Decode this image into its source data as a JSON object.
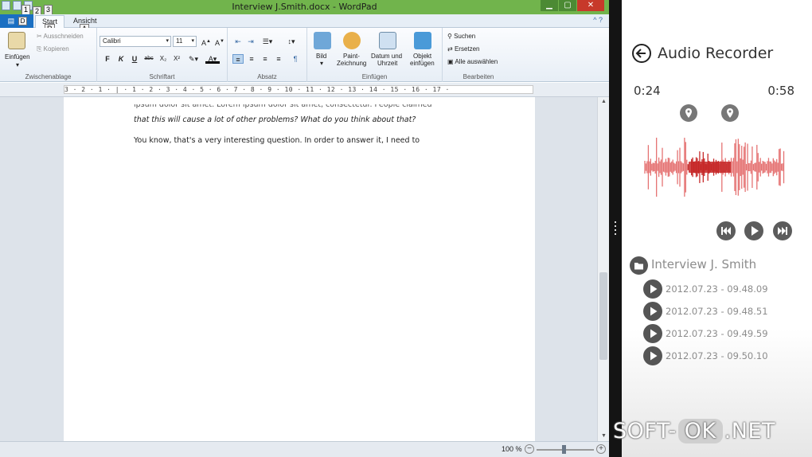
{
  "wordpad": {
    "window_title": "Interview J.Smith.docx - WordPad",
    "tabs": {
      "file_label": "",
      "file_keytip": "D",
      "start": "Start",
      "start_keytip": "R",
      "view": "Ansicht",
      "view_keytip": "A"
    },
    "qat_keytips": [
      "1",
      "2",
      "3"
    ],
    "clipboard": {
      "paste": "Einfügen",
      "cut": "Ausschneiden",
      "copy": "Kopieren",
      "group": "Zwischenablage"
    },
    "font": {
      "family": "Calibri",
      "size": "11",
      "group": "Schriftart",
      "buttons": [
        "F",
        "K",
        "U",
        "abc",
        "X₂",
        "X²"
      ]
    },
    "paragraph": {
      "group": "Absatz"
    },
    "insert": {
      "picture": "Bild",
      "paint_1": "Paint-",
      "paint_2": "Zeichnung",
      "datetime_1": "Datum und",
      "datetime_2": "Uhrzeit",
      "object_1": "Objekt",
      "object_2": "einfügen",
      "group": "Einfügen"
    },
    "edit": {
      "find": "Suchen",
      "replace": "Ersetzen",
      "select_all": "Alle auswählen",
      "group": "Bearbeiten"
    },
    "ruler_text": "3 · 2 · 1 · | · 1 · 2 · 3 · 4 · 5 · 6 · 7 · 8 · 9 · 10 · 11 · 12 · 13 · 14 · 15 · 16 · 17 ·",
    "document": {
      "line_cut": "ipsum dolor sit amet. Lorem ipsum dolor sit amet, consectetur. People claimed",
      "line_italic": "that this will cause a lot of other problems? What do you think about that?",
      "line_regular": "You know, that's a very interesting question. In order to answer it, I need to"
    },
    "status": {
      "zoom": "100 %"
    }
  },
  "recorder": {
    "title": "Audio Recorder",
    "time_elapsed": "0:24",
    "time_total": "0:58",
    "playback_position": 0.41,
    "folder_name": "Interview J. Smith",
    "recordings": [
      "2012.07.23 - 09.48.09",
      "2012.07.23 - 09.48.51",
      "2012.07.23 - 09.49.59",
      "2012.07.23 - 09.50.10"
    ],
    "colors": {
      "waveform": "#e57373",
      "waveform_played": "#c62828",
      "icon_gray": "#555555"
    }
  },
  "watermark": {
    "left": "SOFT-",
    "ok": "OK",
    "right": ".NET"
  }
}
